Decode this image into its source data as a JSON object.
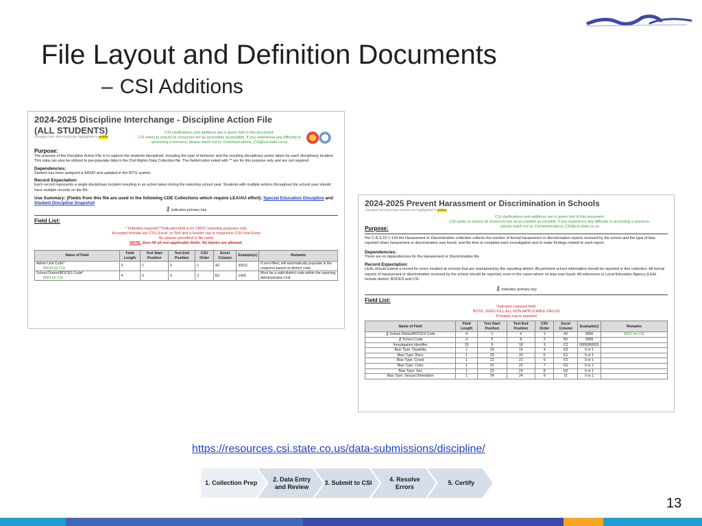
{
  "slide": {
    "title": "File Layout and Definition Documents",
    "subtitle_dash": "–",
    "subtitle": "CSI Additions",
    "url": "https://resources.csi.state.co.us/data-submissions/discipline/",
    "page_number": "13"
  },
  "doc1": {
    "title": "2024-2025 Discipline Interchange - Discipline Action File",
    "subtitle": "(ALL STUDENTS)",
    "changes_note": "Changes from 2023-2024 are highlighted in",
    "changes_highlight": "yellow.",
    "csi_note_1": "CSI clarifications and additions are in green font in this document.",
    "csi_note_2": "CSI seeks to ensure its resources are as accessible as possible. If you experience any difficulty in accessing a resource, please reach out to: Communications_CSI@csi.state.co.us",
    "purpose_heading": "Purpose:",
    "purpose_text": "The purpose of the Discipline Action File is to capture the students disciplined, including the type of behavior and the resulting disciplinary action taken for each disciplinary incident. This data can also be utilized to pre-populate data in the Civil Rights Data Collection file. The fields/codes noted with ** are for this purpose only and are not required.",
    "dependencies_heading": "Dependencies:",
    "dependencies_text": "Student has been assigned a SASID and updated in the RITS system.",
    "record_heading": "Record Expectation:",
    "record_text": "Each record represents a single disciplinary incident resulting in an action taken during the reporting school year. Students with multiple actions throughout the school year should have multiple records on the file.",
    "use_summary": "Use Summary: (Fields from this file are used in the following CDE Collections which require LEA/AU effort):",
    "use_link_1": "Special Education Discipline",
    "use_and": "and",
    "use_link_2": "Student Discipline Snapshot",
    "pk_label": "indicates primary key",
    "field_list_heading": "Field List:",
    "fl_note_1": "* Indicates required **Indicates field is for CRDC reporting purposes only",
    "fl_note_2": "Accepted formats are CSV, Excel, or Text and a header row is required in CSV and Excel",
    "fl_note_3": "No spaces permitted in file name",
    "fl_note_4a": "NOTE:",
    "fl_note_4b": "Zero-fill all non-applicable fields. No blanks are allowed.",
    "table_headers": [
      "Name of Field",
      "Field Length",
      "Text Start Position",
      "Text End Position",
      "CSV Order",
      "Excel Column",
      "Example(s)",
      "Remarks"
    ],
    "rows": [
      {
        "name": "Admin Unit Code*",
        "csi": "80010 for CSI",
        "length": "5",
        "start": "1",
        "end": "5",
        "csv": "1",
        "excel": "A2",
        "example": "30011",
        "remarks": "If zero-filled, will automatically populate in the snapshot based on district code"
      },
      {
        "name": "School District/BOCES Code*",
        "csi": "8001 for CSI",
        "length": "4",
        "start": "6",
        "end": "9",
        "csv": "2",
        "excel": "B2",
        "example": "1420",
        "remarks": "Must be a valid district code within the reporting Administrative Unit"
      }
    ]
  },
  "doc2": {
    "title": "2024-2025 Prevent Harassment or Discrimination in Schools",
    "changes_note": "Changes from previous version are highlighted in",
    "changes_highlight": "yellow.",
    "purpose_heading": "Purpose:",
    "csi_note_1": "CSI clarifications and additions are in green font in this document.",
    "csi_note_2": "CSI seeks to ensure its resources are as accessible as possible. If you experience any difficulty in accessing a resource, please reach out to: Communications_CSI@csi.state.co.us",
    "purpose_text": "Per C.R.S 22-1-143 the Harassment or Discrimination collection collects the number of formal harassment or discrimination reports received by the school and the type of bias reported when harassment or discrimination was found; and the time to complete each investigation and to make findings related to each report.",
    "dependencies_heading": "Dependencies:",
    "dependencies_text": "There are no dependencies for the Harassment or Discrimination file.",
    "record_heading": "Record Expectation:",
    "record_text": "LEAs should submit a record for every incident at schools that are maintained by the reporting district. All pertinent school information should be reported in this collection. All formal reports of harassment or discrimination received by the school should be reported, even in the cases where no bias was found. All references to Local Education Agency (LEA) include district, BOCES and CSI.",
    "pk_label": "indicates primary key",
    "field_list_heading": "Field List:",
    "fl_note_1": "*Indicates required field.",
    "fl_note_2": "NOTE: ZERO-FILL ALL NON-APPLICABLE FIELDS",
    "fl_note_3": "A header row is required",
    "table_headers": [
      "Name of Field",
      "Field Length",
      "Text Start Position",
      "Text End Position",
      "CSV Order",
      "Excel Column",
      "Example(s)",
      "Remarks"
    ],
    "rows": [
      {
        "name": "School District/BOCES Code",
        "pk": true,
        "length": "4",
        "start": "1",
        "end": "4",
        "csv": "1",
        "excel": "A2",
        "example": "0000",
        "remarks": "8001 for CSI"
      },
      {
        "name": "School Code",
        "pk": true,
        "length": "4",
        "start": "5",
        "end": "8",
        "csv": "2",
        "excel": "B2",
        "example": "0000",
        "remarks": ""
      },
      {
        "name": "Investigation Identifier",
        "pk": false,
        "length": "10",
        "start": "9",
        "end": "18",
        "csv": "3",
        "excel": "C2",
        "example": "0000000001",
        "remarks": ""
      },
      {
        "name": "Bias Type: Disability",
        "pk": false,
        "length": "1",
        "start": "19",
        "end": "19",
        "csv": "4",
        "excel": "D2",
        "example": "0 or 1",
        "remarks": ""
      },
      {
        "name": "Bias Type: Race",
        "pk": false,
        "length": "1",
        "start": "20",
        "end": "20",
        "csv": "5",
        "excel": "E2",
        "example": "0 or 1",
        "remarks": ""
      },
      {
        "name": "Bias Type: Creed",
        "pk": false,
        "length": "1",
        "start": "21",
        "end": "21",
        "csv": "6",
        "excel": "F2",
        "example": "0 or 1",
        "remarks": ""
      },
      {
        "name": "Bias Type: Color",
        "pk": false,
        "length": "1",
        "start": "22",
        "end": "22",
        "csv": "7",
        "excel": "G2",
        "example": "0 or 1",
        "remarks": ""
      },
      {
        "name": "Bias Type: Sex",
        "pk": false,
        "length": "1",
        "start": "23",
        "end": "23",
        "csv": "8",
        "excel": "H2",
        "example": "0 or 1",
        "remarks": ""
      },
      {
        "name": "Bias Type: Sexual Orientation",
        "pk": false,
        "length": "1",
        "start": "24",
        "end": "24",
        "csv": "9",
        "excel": "I2",
        "example": "0 or 1",
        "remarks": ""
      }
    ]
  },
  "process_steps": [
    {
      "label": "1. Collection Prep",
      "state": "active"
    },
    {
      "label": "2. Data Entry and Review",
      "state": "pending"
    },
    {
      "label": "3. Submit to CSI",
      "state": "pending"
    },
    {
      "label": "4. Resolve Errors",
      "state": "pending"
    },
    {
      "label": "5. Certify",
      "state": "pending"
    }
  ],
  "colors": {
    "bottom_bar": [
      "#1d9fd0",
      "#3f69b4",
      "#3a4aa5",
      "#f5a623",
      "#1d9fd0"
    ],
    "logo": "#3a4aa5",
    "step_fill": "#d6dee9",
    "step_active": "#eaf0f6"
  }
}
